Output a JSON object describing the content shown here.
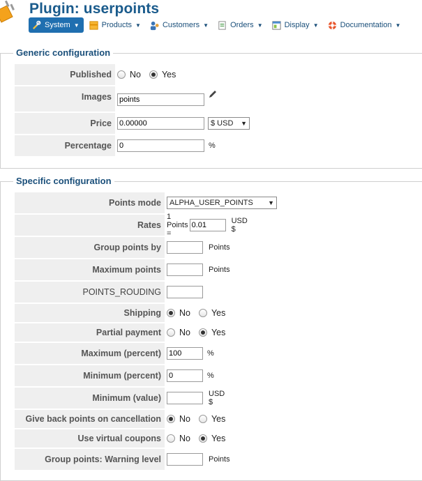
{
  "header": {
    "title": "Plugin: userpoints",
    "menu": [
      {
        "label": "System",
        "icon": "wrench-icon"
      },
      {
        "label": "Products",
        "icon": "products-icon"
      },
      {
        "label": "Customers",
        "icon": "customers-icon"
      },
      {
        "label": "Orders",
        "icon": "orders-icon"
      },
      {
        "label": "Display",
        "icon": "display-icon"
      },
      {
        "label": "Documentation",
        "icon": "lifebuoy-icon"
      }
    ]
  },
  "generic": {
    "legend": "Generic configuration",
    "published": {
      "label": "Published",
      "no": "No",
      "yes": "Yes",
      "selected": "yes"
    },
    "images": {
      "label": "Images",
      "value": "points"
    },
    "price": {
      "label": "Price",
      "value": "0.00000",
      "currency": "$ USD"
    },
    "percentage": {
      "label": "Percentage",
      "value": "0",
      "unit": "%"
    }
  },
  "specific": {
    "legend": "Specific configuration",
    "points_mode": {
      "label": "Points mode",
      "value": "ALPHA_USER_POINTS"
    },
    "rates": {
      "label": "Rates",
      "prefix": "1 Points =",
      "value": "0.01",
      "suffix": "USD $"
    },
    "group_points_by": {
      "label": "Group points by",
      "value": "",
      "unit": "Points"
    },
    "maximum_points": {
      "label": "Maximum points",
      "value": "",
      "unit": "Points"
    },
    "points_rouding": {
      "label": "POINTS_ROUDING",
      "value": ""
    },
    "shipping": {
      "label": "Shipping",
      "no": "No",
      "yes": "Yes",
      "selected": "no"
    },
    "partial_payment": {
      "label": "Partial payment",
      "no": "No",
      "yes": "Yes",
      "selected": "yes"
    },
    "maximum_percent": {
      "label": "Maximum (percent)",
      "value": "100",
      "unit": "%"
    },
    "minimum_percent": {
      "label": "Minimum (percent)",
      "value": "0",
      "unit": "%"
    },
    "minimum_value": {
      "label": "Minimum (value)",
      "value": "",
      "unit": "USD $"
    },
    "give_back": {
      "label": "Give back points on cancellation",
      "no": "No",
      "yes": "Yes",
      "selected": "no"
    },
    "virtual_coupons": {
      "label": "Use virtual coupons",
      "no": "No",
      "yes": "Yes",
      "selected": "yes"
    },
    "warning_level": {
      "label": "Group points: Warning level",
      "value": "",
      "unit": "Points"
    }
  }
}
